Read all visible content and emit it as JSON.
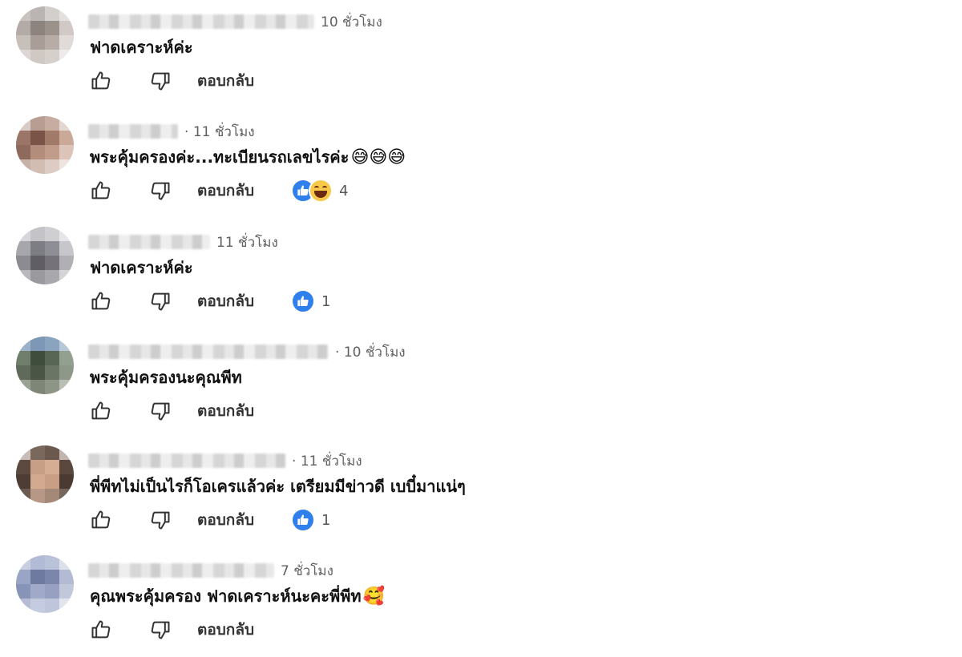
{
  "actions": {
    "reply_label": "ตอบกลับ"
  },
  "comments": [
    {
      "time": "10 ชั่วโมง",
      "time_dot": false,
      "text": "ฟาดเคราะห์ค่ะ",
      "emoji": "",
      "reactions": [],
      "reaction_count": ""
    },
    {
      "time": "11 ชั่วโมง",
      "time_dot": true,
      "text": "พระคุ้มครองค่ะ...ทะเบียนรถเลขไรค่ะ",
      "emoji": "😅😅😅",
      "reactions": [
        "like-reaction",
        "haha-reaction"
      ],
      "reaction_count": "4"
    },
    {
      "time": "11 ชั่วโมง",
      "time_dot": false,
      "text": "ฟาดเคราะห์ค่ะ",
      "emoji": "",
      "reactions": [
        "like-reaction"
      ],
      "reaction_count": "1"
    },
    {
      "time": "10 ชั่วโมง",
      "time_dot": true,
      "text": "พระคุ้มครองนะคุณพีท",
      "emoji": "",
      "reactions": [],
      "reaction_count": ""
    },
    {
      "time": "11 ชั่วโมง",
      "time_dot": true,
      "text": "พี่พีทไม่เป็นไรก็โอเครแล้วค่ะ เตรียมมีข่าวดี เบบี๋มาแน่ๆ",
      "emoji": "",
      "reactions": [
        "like-reaction"
      ],
      "reaction_count": "1"
    },
    {
      "time": "7 ชั่วโมง",
      "time_dot": false,
      "text": "คุณพระคุ้มครอง ฟาดเคราะห์นะคะพี่พีท",
      "emoji": "🥰",
      "reactions": [],
      "reaction_count": ""
    }
  ],
  "icons": {
    "like": "thumbs-up-icon",
    "dislike": "thumbs-down-icon"
  },
  "colors": {
    "reaction_like": "#2f7fed",
    "reaction_haha": "#f7c948",
    "time_text": "#606060"
  }
}
